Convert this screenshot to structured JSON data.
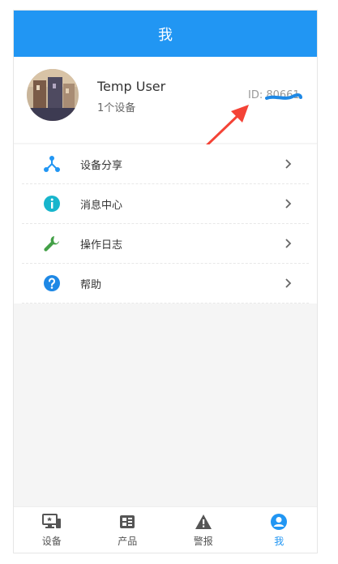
{
  "header": {
    "title": "我"
  },
  "profile": {
    "name": "Temp User",
    "device_count": "1个设备",
    "id_text": "ID: 80661"
  },
  "menu": {
    "items": [
      {
        "label": "设备分享",
        "icon": "share-icon",
        "color": "#2196f3"
      },
      {
        "label": "消息中心",
        "icon": "info-icon",
        "color": "#17b5cc"
      },
      {
        "label": "操作日志",
        "icon": "wrench-icon",
        "color": "#43a047"
      },
      {
        "label": "帮助",
        "icon": "help-icon",
        "color": "#1e88e5"
      }
    ]
  },
  "tabbar": {
    "tabs": [
      {
        "label": "设备",
        "icon": "device-icon",
        "active": false
      },
      {
        "label": "产品",
        "icon": "product-icon",
        "active": false
      },
      {
        "label": "警报",
        "icon": "alert-icon",
        "active": false
      },
      {
        "label": "我",
        "icon": "user-icon",
        "active": true
      }
    ]
  },
  "colors": {
    "primary": "#2196f3",
    "annotation_arrow": "#f44336"
  }
}
